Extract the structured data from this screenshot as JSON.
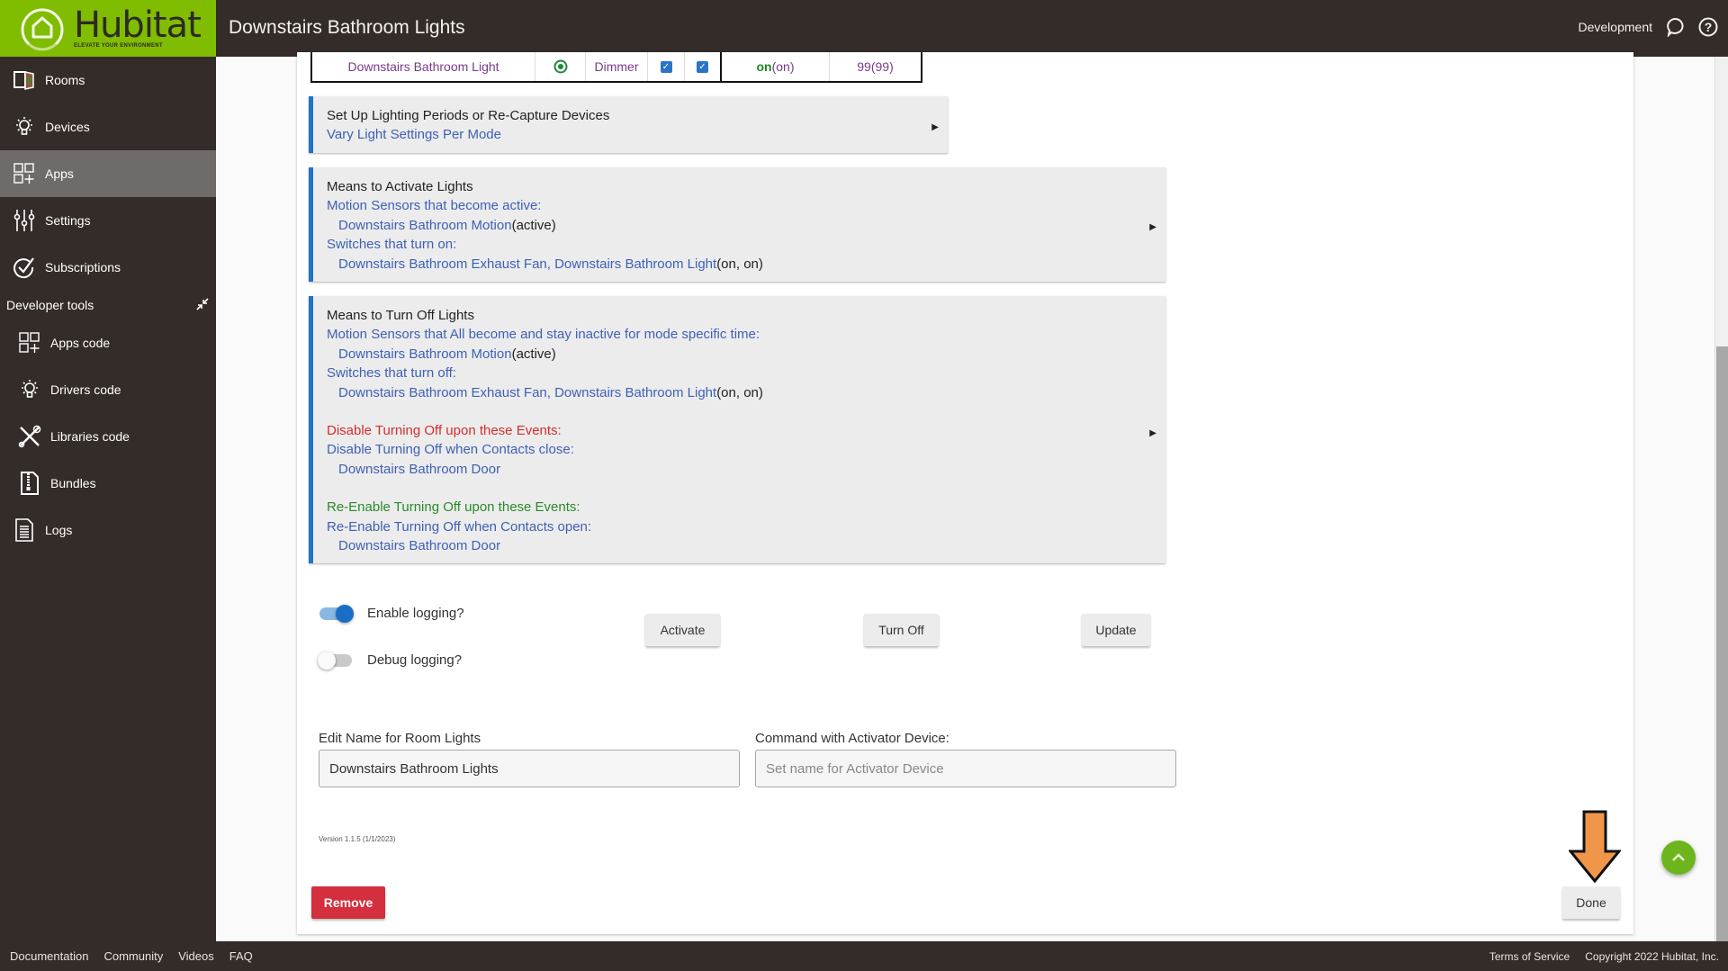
{
  "header": {
    "brand": "Hubitat",
    "brand_tagline": "ELEVATE YOUR ENVIRONMENT",
    "title": "Downstairs Bathroom Lights",
    "environment": "Development",
    "chat_icon": "chat-bubble-icon",
    "help_icon": "help-circle-icon"
  },
  "sidebar": {
    "items": [
      {
        "label": "Rooms",
        "icon": "rooms-door-icon"
      },
      {
        "label": "Devices",
        "icon": "lightbulb-icon"
      },
      {
        "label": "Apps",
        "icon": "apps-grid-icon",
        "active": true
      },
      {
        "label": "Settings",
        "icon": "sliders-icon"
      },
      {
        "label": "Subscriptions",
        "icon": "check-circle-icon"
      }
    ],
    "dev_tools_label": "Developer tools",
    "dev_items": [
      {
        "label": "Apps code",
        "icon": "apps-grid-icon"
      },
      {
        "label": "Drivers code",
        "icon": "lightbulb-icon"
      },
      {
        "label": "Libraries code",
        "icon": "tools-icon"
      },
      {
        "label": "Bundles",
        "icon": "zip-file-icon"
      }
    ],
    "logs_label": "Logs"
  },
  "device_row": {
    "name": "Downstairs Bathroom Light",
    "type": "Dimmer",
    "selected": true,
    "check1": true,
    "check2": true,
    "state_current": "on",
    "state_captured": "(on)",
    "level_current": "99",
    "level_captured": "(99)"
  },
  "periods_section": {
    "title": "Set Up Lighting Periods or Re-Capture Devices",
    "subtitle": "Vary Light Settings Per Mode"
  },
  "activate_section": {
    "title": "Means to Activate Lights",
    "motion_label": "Motion Sensors that become active:",
    "motion_device": "Downstairs Bathroom Motion",
    "motion_state": "(active)",
    "switch_label": "Switches that turn on:",
    "switch_devices": "Downstairs Bathroom Exhaust Fan, Downstairs Bathroom Light",
    "switch_state": "(on, on)"
  },
  "turnoff_section": {
    "title": "Means to Turn Off Lights",
    "motion_label": "Motion Sensors that All become and stay inactive for mode specific time:",
    "motion_device": "Downstairs Bathroom Motion",
    "motion_state": "(active)",
    "switch_label": "Switches that turn off:",
    "switch_devices": "Downstairs Bathroom Exhaust Fan, Downstairs Bathroom Light",
    "switch_state": "(on, on)",
    "disable_title": "Disable Turning Off upon these Events:",
    "disable_label": "Disable Turning Off when Contacts close:",
    "disable_device": "Downstairs Bathroom Door",
    "reenable_title": "Re-Enable Turning Off upon these Events:",
    "reenable_label": "Re-Enable Turning Off when Contacts open:",
    "reenable_device": "Downstairs Bathroom Door"
  },
  "options": {
    "enable_logging_label": "Enable logging?",
    "enable_logging": true,
    "debug_logging_label": "Debug logging?",
    "debug_logging": false
  },
  "actions": {
    "activate": "Activate",
    "turn_off": "Turn Off",
    "update": "Update",
    "remove": "Remove",
    "done": "Done"
  },
  "form": {
    "name_label": "Edit Name for Room Lights",
    "name_value": "Downstairs Bathroom Lights",
    "activator_label": "Command with Activator Device:",
    "activator_value": "",
    "activator_placeholder": "Set name for Activator Device"
  },
  "version": "Version 1.1.5 (1/1/2023)",
  "footer": {
    "links": [
      "Documentation",
      "Community",
      "Videos",
      "FAQ"
    ],
    "terms": "Terms of Service",
    "copyright": "Copyright 2022 Hubitat, Inc."
  },
  "colors": {
    "brand_green": "#80bc00",
    "dark_bg": "#342c28",
    "section_accent": "#1f74c4",
    "link_blue": "#3f60b5",
    "alert_red": "#d42d2d",
    "ok_green": "#2a8a2a",
    "remove_red": "#d32f3f",
    "annotation_arrow": "#f0964a"
  }
}
